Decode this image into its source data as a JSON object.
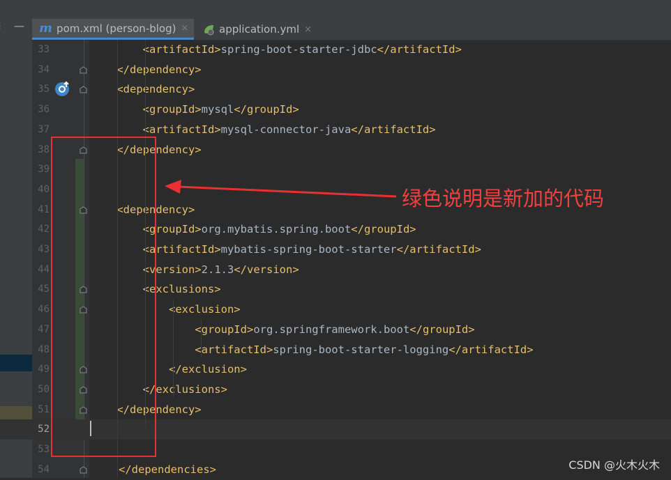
{
  "left_panel": {
    "minimize_label": "—"
  },
  "tabs": [
    {
      "label": "pom.xml (person-blog)",
      "active": true,
      "icon": "maven-icon"
    },
    {
      "label": "application.yml",
      "active": false,
      "icon": "spring-icon"
    }
  ],
  "tab_close": "×",
  "code_lines": [
    {
      "num": "33",
      "indent": "        ",
      "parts": [
        [
          "tag",
          "<artifactId>"
        ],
        [
          "txt",
          "spring-boot-starter-jdbc"
        ],
        [
          "tag",
          "</artifactId>"
        ]
      ]
    },
    {
      "num": "34",
      "indent": "    ",
      "parts": [
        [
          "tag",
          "</dependency>"
        ]
      ]
    },
    {
      "num": "35",
      "indent": "    ",
      "parts": [
        [
          "tag",
          "<dependency>"
        ]
      ]
    },
    {
      "num": "36",
      "indent": "        ",
      "parts": [
        [
          "tag",
          "<groupId>"
        ],
        [
          "txt",
          "mysql"
        ],
        [
          "tag",
          "</groupId>"
        ]
      ]
    },
    {
      "num": "37",
      "indent": "        ",
      "parts": [
        [
          "tag",
          "<artifactId>"
        ],
        [
          "txt",
          "mysql-connector-java"
        ],
        [
          "tag",
          "</artifactId>"
        ]
      ]
    },
    {
      "num": "38",
      "indent": "    ",
      "parts": [
        [
          "tag",
          "</dependency>"
        ]
      ]
    },
    {
      "num": "39",
      "indent": "",
      "parts": []
    },
    {
      "num": "40",
      "indent": "",
      "parts": []
    },
    {
      "num": "41",
      "indent": "    ",
      "parts": [
        [
          "tag",
          "<dependency>"
        ]
      ]
    },
    {
      "num": "42",
      "indent": "        ",
      "parts": [
        [
          "tag",
          "<groupId>"
        ],
        [
          "txt",
          "org.mybatis.spring.boot"
        ],
        [
          "tag",
          "</groupId>"
        ]
      ]
    },
    {
      "num": "43",
      "indent": "        ",
      "parts": [
        [
          "tag",
          "<artifactId>"
        ],
        [
          "txt",
          "mybatis-spring-boot-starter"
        ],
        [
          "tag",
          "</artifactId>"
        ]
      ]
    },
    {
      "num": "44",
      "indent": "        ",
      "parts": [
        [
          "tag",
          "<version>"
        ],
        [
          "txt",
          "2.1.3"
        ],
        [
          "tag",
          "</version>"
        ]
      ]
    },
    {
      "num": "45",
      "indent": "        ",
      "parts": [
        [
          "tag",
          "<exclusions>"
        ]
      ]
    },
    {
      "num": "46",
      "indent": "            ",
      "parts": [
        [
          "tag",
          "<exclusion>"
        ]
      ]
    },
    {
      "num": "47",
      "indent": "                ",
      "parts": [
        [
          "tag",
          "<groupId>"
        ],
        [
          "txt",
          "org.springframework.boot"
        ],
        [
          "tag",
          "</groupId>"
        ]
      ]
    },
    {
      "num": "48",
      "indent": "                ",
      "parts": [
        [
          "tag",
          "<artifactId>"
        ],
        [
          "txt",
          "spring-boot-starter-logging"
        ],
        [
          "tag",
          "</artifactId>"
        ]
      ]
    },
    {
      "num": "49",
      "indent": "            ",
      "parts": [
        [
          "tag",
          "</exclusion>"
        ]
      ]
    },
    {
      "num": "50",
      "indent": "        ",
      "parts": [
        [
          "tag",
          "</exclusions>"
        ]
      ]
    },
    {
      "num": "51",
      "indent": "    ",
      "parts": [
        [
          "tag",
          "</dependency>"
        ]
      ]
    },
    {
      "num": "52",
      "indent": "",
      "parts": [],
      "current": true
    },
    {
      "num": "53",
      "indent": "",
      "parts": []
    },
    {
      "num": "54",
      "indent": "",
      "parts": [
        [
          "tag",
          "</dependencies>"
        ]
      ]
    }
  ],
  "fold_markers_on_lines": [
    "34",
    "35",
    "38",
    "41",
    "45",
    "46",
    "49",
    "50",
    "51",
    "54"
  ],
  "annotation": "绿色说明是新加的代码",
  "watermark": "CSDN @火木火木",
  "colors": {
    "tag": "#e8bf6a",
    "text": "#a9b7c6",
    "added_line_marker": "#384c38",
    "annotation_red": "#e83030"
  }
}
